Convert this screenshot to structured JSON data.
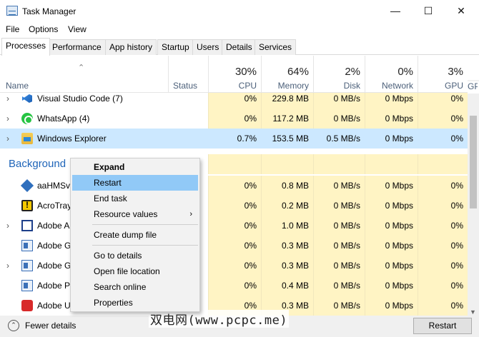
{
  "window": {
    "title": "Task Manager",
    "controls": [
      "—",
      "☐",
      "✕"
    ]
  },
  "menubar": [
    "File",
    "Options",
    "View"
  ],
  "tabs": [
    "Processes",
    "Performance",
    "App history",
    "Startup",
    "Users",
    "Details",
    "Services"
  ],
  "active_tab": "Processes",
  "columns": {
    "name": "Name",
    "status": "Status",
    "cpu": {
      "pct": "30%",
      "label": "CPU"
    },
    "memory": {
      "pct": "64%",
      "label": "Memory"
    },
    "disk": {
      "pct": "2%",
      "label": "Disk"
    },
    "network": {
      "pct": "0%",
      "label": "Network"
    },
    "gpu": {
      "pct": "3%",
      "label": "GPU"
    },
    "extra": "GPU"
  },
  "rows": [
    {
      "name": "Visual Studio Code (7)",
      "icon": "vscode-icon",
      "cpu": "0%",
      "memory": "229.8 MB",
      "disk": "0 MB/s",
      "network": "0 Mbps",
      "gpu": "0%"
    },
    {
      "name": "WhatsApp (4)",
      "icon": "whatsapp-icon",
      "cpu": "0%",
      "memory": "117.2 MB",
      "disk": "0 MB/s",
      "network": "0 Mbps",
      "gpu": "0%"
    },
    {
      "name": "Windows Explorer",
      "icon": "folder-icon",
      "cpu": "0.7%",
      "memory": "153.5 MB",
      "disk": "0.5 MB/s",
      "network": "0 Mbps",
      "gpu": "0%"
    },
    {
      "name": "aaHMSv",
      "icon": "service-icon",
      "cpu": "0%",
      "memory": "0.8 MB",
      "disk": "0 MB/s",
      "network": "0 Mbps",
      "gpu": "0%"
    },
    {
      "name": "AcroTray",
      "icon": "warning-icon",
      "cpu": "0%",
      "memory": "0.2 MB",
      "disk": "0 MB/s",
      "network": "0 Mbps",
      "gpu": "0%"
    },
    {
      "name": "Adobe A",
      "icon": "window-icon",
      "cpu": "0%",
      "memory": "1.0 MB",
      "disk": "0 MB/s",
      "network": "0 Mbps",
      "gpu": "0%"
    },
    {
      "name": "Adobe G",
      "icon": "doc-icon",
      "cpu": "0%",
      "memory": "0.3 MB",
      "disk": "0 MB/s",
      "network": "0 Mbps",
      "gpu": "0%"
    },
    {
      "name": "Adobe G",
      "icon": "doc-icon",
      "cpu": "0%",
      "memory": "0.3 MB",
      "disk": "0 MB/s",
      "network": "0 Mbps",
      "gpu": "0%"
    },
    {
      "name": "Adobe P",
      "icon": "doc-icon",
      "cpu": "0%",
      "memory": "0.4 MB",
      "disk": "0 MB/s",
      "network": "0 Mbps",
      "gpu": "0%"
    },
    {
      "name": "Adobe U",
      "icon": "adobe-red-icon",
      "cpu": "0%",
      "memory": "0.3 MB",
      "disk": "0 MB/s",
      "network": "0 Mbps",
      "gpu": "0%"
    }
  ],
  "group_title": "Background",
  "context_menu": {
    "items": [
      "Expand",
      "Restart",
      "End task",
      "Resource values",
      "Create dump file",
      "Go to details",
      "Open file location",
      "Search online",
      "Properties"
    ],
    "highlighted": "Restart",
    "submenu_arrow": "›"
  },
  "footer": {
    "fewer_details": "Fewer details",
    "restart_button": "Restart"
  },
  "watermark": "双电网(www.pcpc.me)",
  "colors": {
    "highlight_yellow": "#fff4c4",
    "selection": "#cce8ff",
    "menu_highlight": "#91c9f7",
    "group_blue": "#1e64b8"
  }
}
